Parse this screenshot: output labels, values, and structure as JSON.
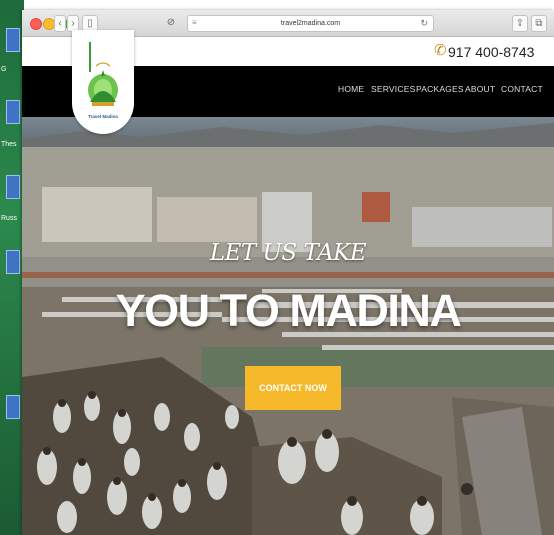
{
  "desktop": {
    "labels": [
      "G",
      "Thes",
      "Russ"
    ]
  },
  "browser": {
    "url": "travel2madina.com"
  },
  "contact": {
    "phone": "917 400-8743",
    "phone_icon": "phone-icon"
  },
  "nav": {
    "items": [
      "HOME",
      "SERVICES",
      "PACKAGES",
      "ABOUT",
      "CONTACT"
    ]
  },
  "logo": {
    "name": "Travel Madina"
  },
  "hero": {
    "subtitle": "LET US TAKE",
    "title": "YOU TO MADINA",
    "cta": "CONTACT NOW"
  },
  "colors": {
    "accent": "#f5b92b",
    "nav_bg": "#000000",
    "phone_icon": "#c98a1e"
  }
}
